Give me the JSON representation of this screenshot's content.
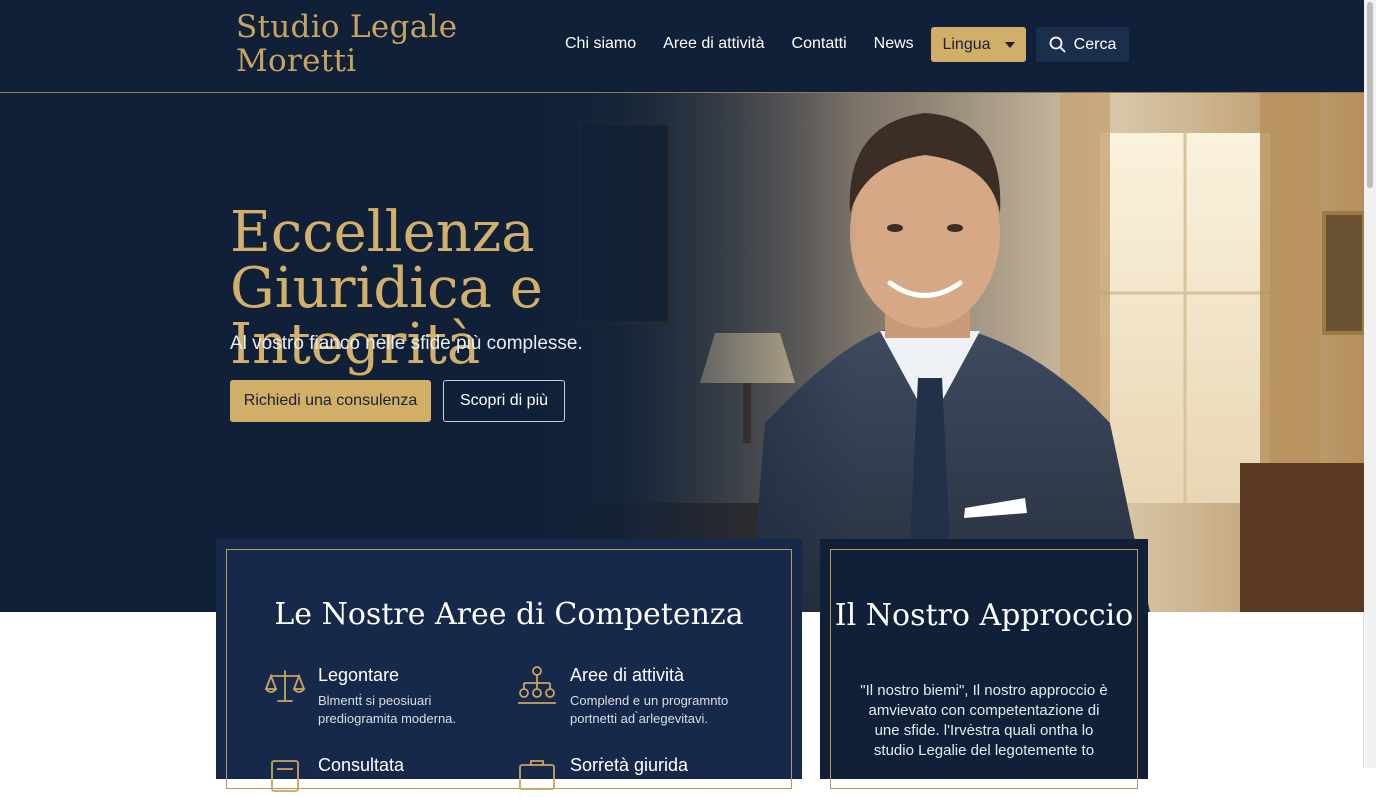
{
  "header": {
    "logo": "Studio Legale Moretti",
    "nav": [
      "Chi siamo",
      "Aree di attività",
      "Contatti",
      "News"
    ],
    "language_button": "Lingua",
    "search_button": "Cerca"
  },
  "hero": {
    "title": "Eccellenza Giuridica e Integrità",
    "subtitle": "Al vostro fianco nelle sfide più complesse.",
    "primary_cta": "Richiedi una consulenza",
    "secondary_cta": "Scopri di più"
  },
  "competenze": {
    "title": "Le Nostre Aree di Competenza",
    "items": [
      {
        "title": "Legontare",
        "desc": "Blmentṫ si peosiuari prediogramita moderna.",
        "icon": "scales-icon"
      },
      {
        "title": "Aree di attività",
        "desc": "Complend e un programnto portnetti ad ̀arlegevitavi.",
        "icon": "hierarchy-icon"
      },
      {
        "title": "Consultata",
        "desc": "",
        "icon": "document-icon"
      },
      {
        "title": "Sorṙetà giurida",
        "desc": "",
        "icon": "briefcase-icon"
      }
    ]
  },
  "approccio": {
    "title": "Il Nostro Approccio",
    "quote": "\"Il nostro biemi\", Il nostro approccio è amvievato con competentazione di une sfide. l'Irvėstra quali ontha lo studio Legalie del legotemente to"
  },
  "colors": {
    "navy": "#0f2038",
    "card_navy": "#17294a",
    "gold": "#d1af69",
    "gold_text": "#c9a45f"
  }
}
